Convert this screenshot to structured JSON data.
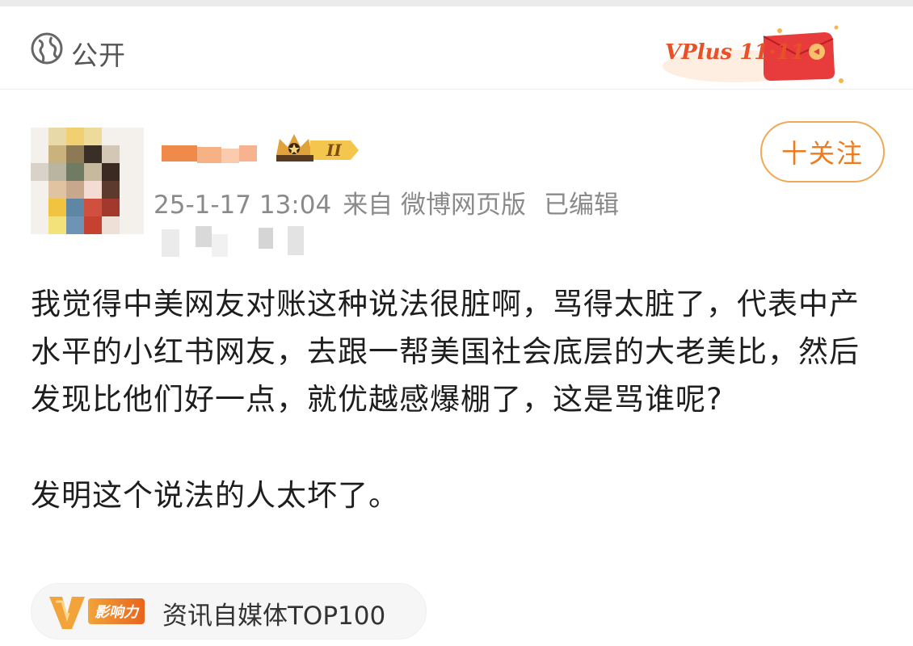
{
  "header": {
    "visibility_label": "公开",
    "promo_text": "VPlus 11·11"
  },
  "author": {
    "level_badge": "II",
    "timestamp": "25-1-17 13:04",
    "source": "来自 微博网页版",
    "edited": "已编辑"
  },
  "follow_button": {
    "label": "十关注"
  },
  "post": {
    "paragraphs": [
      "我觉得中美网友对账这种说法很脏啊，骂得太脏了，代表中产水平的小红书网友，去跟一帮美国社会底层的大老美比，然后发现比他们好一点，就优越感爆棚了，这是骂谁呢?",
      "发明这个说法的人太坏了。"
    ]
  },
  "influence": {
    "badge_label": "影响力",
    "text": "资讯自媒体TOP100"
  },
  "colors": {
    "accent_orange": "#ee7b1e",
    "follow_border": "#f0a855",
    "meta_gray": "#8a8a8a",
    "promo_red": "#e8502a"
  },
  "icons": [
    "globe-icon",
    "crown-icon",
    "gift-envelope-icon",
    "v-influence-icon"
  ]
}
